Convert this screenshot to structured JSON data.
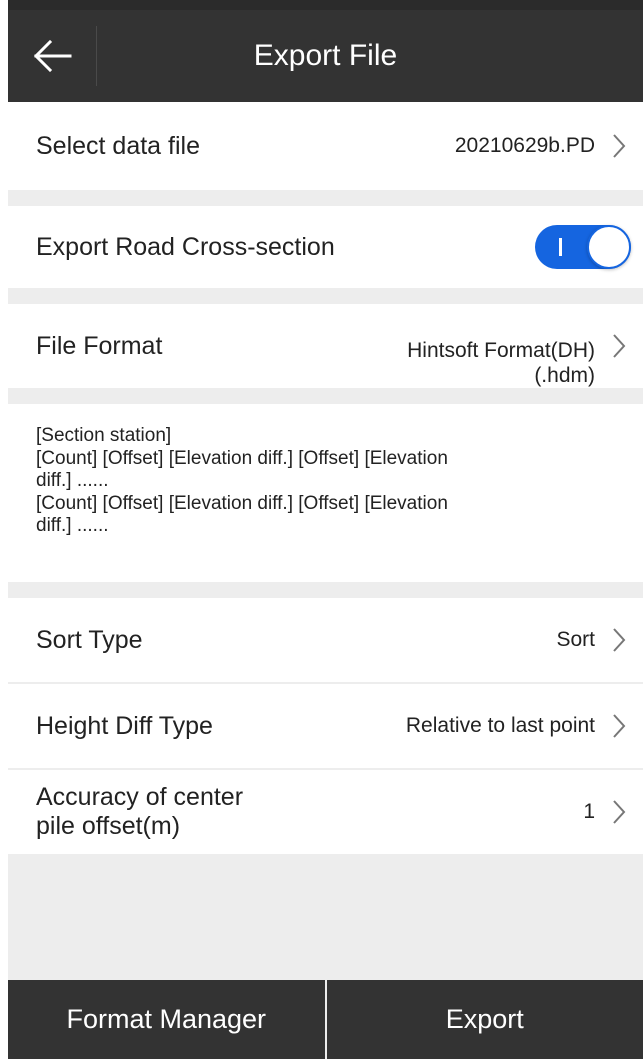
{
  "header": {
    "title": "Export File"
  },
  "rows": {
    "data_file": {
      "label": "Select data file",
      "value": "20210629b.PD"
    },
    "export_cross_section": {
      "label": "Export Road Cross-section",
      "toggle_on": true
    },
    "file_format": {
      "label": "File Format",
      "value_line1": "Hintsoft Format(DH)",
      "value_line2": "(.hdm)"
    },
    "sort_type": {
      "label": "Sort Type",
      "value": "Sort"
    },
    "height_diff_type": {
      "label": "Height Diff Type",
      "value": "Relative to last point"
    },
    "accuracy": {
      "label_line1": "Accuracy of center",
      "label_line2": "pile offset(m)",
      "value": "1"
    }
  },
  "format_description": {
    "lines": [
      "[Section station]",
      "[Count] [Offset] [Elevation diff.] [Offset] [Elevation",
      "diff.] ......",
      "[Count] [Offset] [Elevation diff.] [Offset] [Elevation",
      "diff.] ......"
    ]
  },
  "footer": {
    "format_manager_label": "Format Manager",
    "export_label": "Export"
  },
  "colors": {
    "header_bg": "#333333",
    "page_bg": "#ededed",
    "toggle_accent": "#1565e0"
  },
  "icons": {
    "back": "arrow-left-icon",
    "chevron": "chevron-right-icon"
  }
}
